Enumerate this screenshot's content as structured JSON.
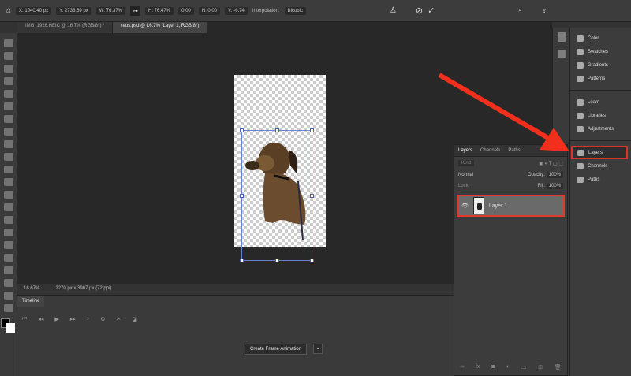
{
  "options_bar": {
    "x": "X: 1040.40 px",
    "y": "Y: 2738.69 px",
    "w": "W: 76.37%",
    "h": "H: 76.47%",
    "angle": "0.00",
    "hskew": "H: 0.00",
    "vskew": "V: -6.74",
    "interpolation_label": "Interpolation:",
    "interpolation_value": "Bicubic"
  },
  "tabs": [
    {
      "label": "IMG_1926.HEIC @ 16.7% (RGB/8*) *"
    },
    {
      "label": "reus.psd @ 16.7% (Layer 1, RGB/8*)"
    }
  ],
  "status": {
    "zoom": "16.67%",
    "doc_size": "2270 px x 3967 px (72 ppi)"
  },
  "timeline": {
    "tab": "Timeline",
    "create_button": "Create Frame Animation"
  },
  "layers_panel": {
    "tabs": [
      "Layers",
      "Channels",
      "Paths"
    ],
    "filter": "Kind",
    "blend_mode": "Normal",
    "opacity_label": "Opacity:",
    "opacity": "100%",
    "lock_label": "Lock:",
    "fill_label": "Fill:",
    "fill": "100%",
    "layers": [
      {
        "name": "Layer 1"
      }
    ]
  },
  "side_panels": {
    "group1": [
      "Color",
      "Swatches",
      "Gradients",
      "Patterns"
    ],
    "group2": [
      "Learn",
      "Libraries",
      "Adjustments"
    ],
    "group3": [
      "Layers",
      "Channels",
      "Paths"
    ]
  },
  "colors": {
    "highlight": "#e03a2a",
    "arrow": "#f0301c"
  }
}
